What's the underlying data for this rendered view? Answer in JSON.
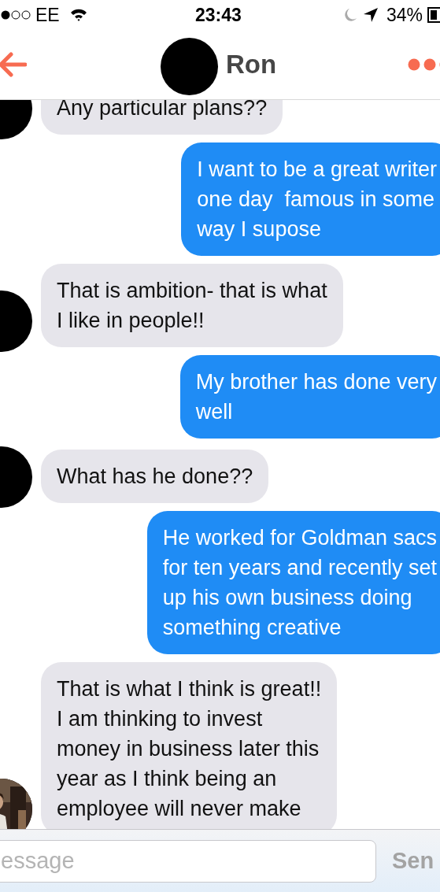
{
  "status_bar": {
    "carrier": "EE",
    "time": "23:43",
    "battery": "34%"
  },
  "contact": {
    "name": "Ron"
  },
  "messages": [
    {
      "kind": "incoming",
      "avatar": {
        "kind": "blacked_out"
      },
      "text": "Any particular plans??"
    },
    {
      "kind": "outgoing",
      "text": "I want to be a great writer\none day  famous in some\nway I supose"
    },
    {
      "kind": "incoming",
      "avatar": {
        "kind": "blacked_out"
      },
      "text": "That is ambition- that is what\nI like in people!!"
    },
    {
      "kind": "outgoing",
      "text": "My brother has done very\nwell"
    },
    {
      "kind": "incoming",
      "avatar": {
        "kind": "blacked_out"
      },
      "text": "What has he done??"
    },
    {
      "kind": "outgoing",
      "text": "He worked for Goldman sacs\nfor ten years and recently set\nup his own business doing\nsomething creative"
    },
    {
      "kind": "incoming",
      "text": "That is what I think is great!!\nI am thinking to invest\nmoney in business later this\nyear as I think being an\nemployee will never make"
    }
  ],
  "composer": {
    "placeholder": "essage",
    "send": "Sen"
  }
}
